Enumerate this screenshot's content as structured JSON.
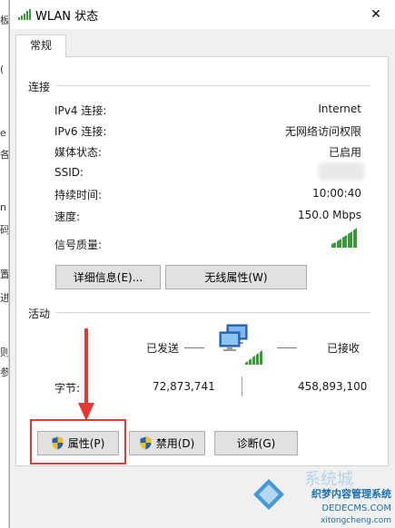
{
  "background_window": {
    "fragments": [
      "板",
      "(",
      "e",
      "各",
      "n",
      "码",
      "置",
      "进",
      "则",
      "参"
    ]
  },
  "window": {
    "title": "WLAN 状态",
    "close_glyph": "✕"
  },
  "tab": {
    "label": "常规"
  },
  "connection": {
    "title": "连接",
    "rows": [
      {
        "label": "IPv4 连接:",
        "value": "Internet"
      },
      {
        "label": "IPv6 连接:",
        "value": "无网络访问权限"
      },
      {
        "label": "媒体状态:",
        "value": "已启用"
      },
      {
        "label": "SSID:",
        "value": ""
      },
      {
        "label": "持续时间:",
        "value": "10:00:40"
      },
      {
        "label": "速度:",
        "value": "150.0 Mbps"
      },
      {
        "label": "信号质量:",
        "value": ""
      }
    ],
    "signal_bars_filled": 5,
    "signal_bars_total": 5,
    "details_button": "详细信息(E)...",
    "wireless_props_button": "无线属性(W)"
  },
  "activity": {
    "title": "活动",
    "sent_label": "已发送",
    "received_label": "已接收",
    "bytes_label": "字节:",
    "bytes_sent": "72,873,741",
    "bytes_received": "458,893,100"
  },
  "buttons": {
    "properties": "属性(P)",
    "disable": "禁用(D)",
    "diagnose": "诊断(G)"
  },
  "colors": {
    "accent_red": "#e53935",
    "signal_green": "#3a9a3a",
    "shield_blue": "#2a5db0",
    "shield_yellow": "#f2c21b"
  },
  "watermark": {
    "line1": "织梦内容管理系统",
    "line2": "DEDECMS.COM",
    "line3": "xitongcheng.com",
    "partial": "系统城"
  }
}
